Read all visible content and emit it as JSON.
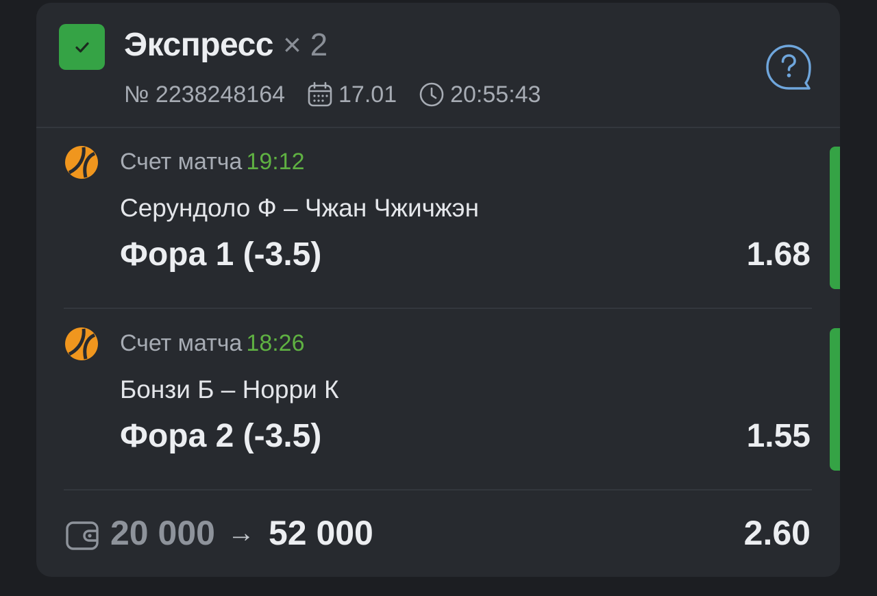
{
  "header": {
    "title": "Экспресс",
    "multiplier": "× 2",
    "bet_number": "№ 2238248164",
    "date": "17.01",
    "time": "20:55:43",
    "status_icon": "check-icon",
    "help_icon": "question-bubble-icon"
  },
  "events": [
    {
      "sport_icon": "tennis-ball-icon",
      "market": "Счет матча",
      "time": "19:12",
      "teams": "Серундоло Ф – Чжан Чжичжэн",
      "pick": "Фора 1 (-3.5)",
      "odds": "1.68"
    },
    {
      "sport_icon": "tennis-ball-icon",
      "market": "Счет матча",
      "time": "18:26",
      "teams": "Бонзи Б – Норри К",
      "pick": "Фора 2 (-3.5)",
      "odds": "1.55"
    }
  ],
  "footer": {
    "wallet_icon": "wallet-icon",
    "stake": "20 000",
    "arrow": "→",
    "win": "52 000",
    "total_odds": "2.60"
  },
  "colors": {
    "accent_green": "#35a345",
    "time_green": "#5fb142",
    "sport_orange": "#f0961e",
    "help_blue": "#6fa6dc"
  }
}
